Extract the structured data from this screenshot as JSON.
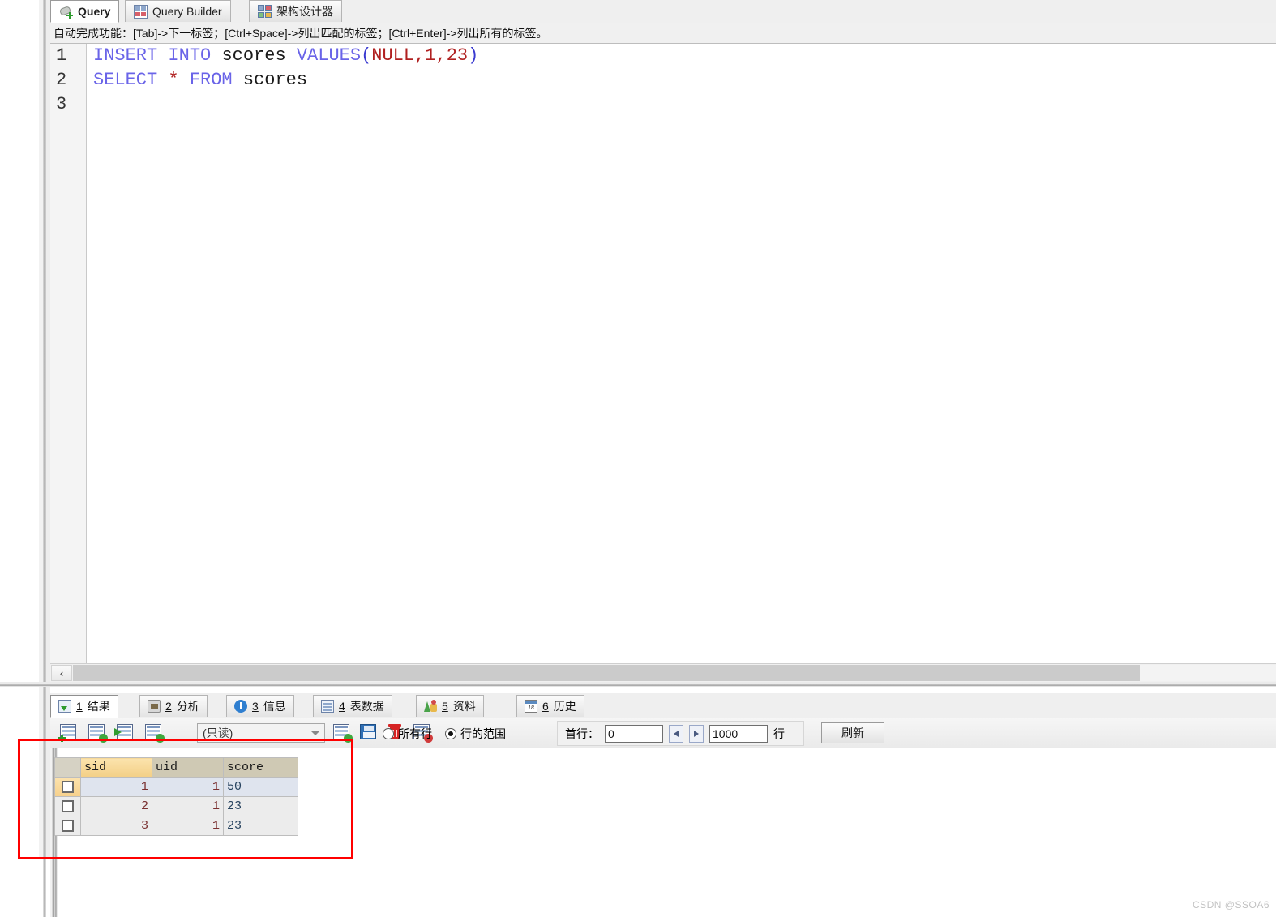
{
  "top_tabs": [
    {
      "label": "Query",
      "icon": "query-key-icon",
      "active": true
    },
    {
      "label": "Query Builder",
      "icon": "query-builder-grid-icon",
      "active": false
    },
    {
      "label": "架构设计器",
      "icon": "schema-designer-icon",
      "active": false
    }
  ],
  "hint": {
    "text": "自动完成功能：[Tab]->下一标签；[Ctrl+Space]->列出匹配的标签；[Ctrl+Enter]->列出所有的标签。"
  },
  "editor": {
    "line_numbers": [
      "1",
      "2",
      "3"
    ],
    "lines": [
      {
        "tokens": [
          {
            "t": "INSERT",
            "c": "kw"
          },
          {
            "t": " ",
            "c": "idn"
          },
          {
            "t": "INTO",
            "c": "kw"
          },
          {
            "t": " ",
            "c": "idn"
          },
          {
            "t": "scores",
            "c": "idn"
          },
          {
            "t": " ",
            "c": "idn"
          },
          {
            "t": "VALUES",
            "c": "kw"
          },
          {
            "t": "(",
            "c": "pn"
          },
          {
            "t": "NULL",
            "c": "nul"
          },
          {
            "t": ",",
            "c": "op"
          },
          {
            "t": "1",
            "c": "num"
          },
          {
            "t": ",",
            "c": "op"
          },
          {
            "t": "23",
            "c": "num"
          },
          {
            "t": ")",
            "c": "pn"
          }
        ],
        "plain": "INSERT INTO scores VALUES(NULL,1,23)"
      },
      {
        "tokens": [
          {
            "t": "SELECT",
            "c": "kw"
          },
          {
            "t": " ",
            "c": "idn"
          },
          {
            "t": "*",
            "c": "op"
          },
          {
            "t": " ",
            "c": "idn"
          },
          {
            "t": "FROM",
            "c": "kw"
          },
          {
            "t": " ",
            "c": "idn"
          },
          {
            "t": "scores",
            "c": "idn"
          }
        ],
        "plain": "SELECT * FROM scores"
      },
      {
        "tokens": [],
        "plain": ""
      }
    ]
  },
  "editor_scrollbar": {
    "left_arrow": "‹"
  },
  "result_tabs": [
    {
      "num": "1",
      "label": "结果",
      "icon": "result-grid-icon",
      "active": true
    },
    {
      "num": "2",
      "label": "分析",
      "icon": "analyze-icon",
      "active": false
    },
    {
      "num": "3",
      "label": "信息",
      "icon": "info-icon",
      "active": false
    },
    {
      "num": "4",
      "label": "表数据",
      "icon": "table-data-icon",
      "active": false
    },
    {
      "num": "5",
      "label": "资料",
      "icon": "profile-chart-icon",
      "active": false
    },
    {
      "num": "6",
      "label": "历史",
      "icon": "history-calendar-icon",
      "active": false
    }
  ],
  "result_toolbar": {
    "icons": [
      "grid-add-icon",
      "grid-refresh-icon",
      "grid-apply-icon",
      "grid-revert-icon",
      "grid-export-icon",
      "save-icon",
      "delete-row-icon",
      "grid-cancel-icon"
    ],
    "mode_select": {
      "value": "(只读)",
      "options": [
        "(只读)"
      ]
    },
    "radios": [
      {
        "label": "所有行",
        "selected": false
      },
      {
        "label": "行的范围",
        "selected": true
      }
    ],
    "first_row_label": "首行：",
    "first_row_value": "0",
    "count_value": "1000",
    "rows_unit": "行",
    "refresh_label": "刷新"
  },
  "result_grid": {
    "columns": [
      "sid",
      "uid",
      "score"
    ],
    "active_column": "sid",
    "rows": [
      {
        "sid": "1",
        "uid": "1",
        "score": "50",
        "selected": true
      },
      {
        "sid": "2",
        "uid": "1",
        "score": "23",
        "selected": false
      },
      {
        "sid": "3",
        "uid": "1",
        "score": "23",
        "selected": false
      }
    ]
  },
  "annotation": {
    "shape": "rectangle",
    "color": "#ff0000"
  },
  "watermark": {
    "text": "CSDN @SSOA6"
  },
  "colors": {
    "keyword": "#6a64e8",
    "literal": "#b02020",
    "paren": "#3a3ad0",
    "header_active": "#f3cf86",
    "header": "#cfc9b4",
    "annotation": "#ff0000"
  }
}
